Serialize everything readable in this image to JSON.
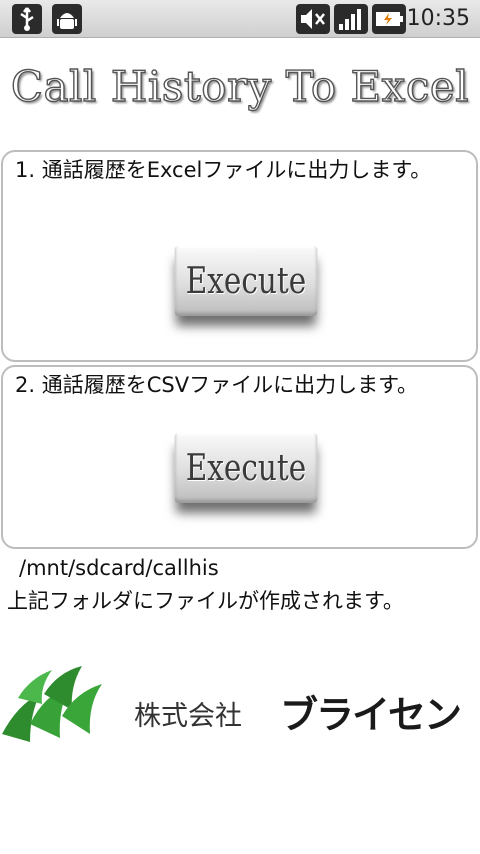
{
  "status_bar": {
    "time": "10:35",
    "icons": [
      "usb-icon",
      "android-debug-icon",
      "mute-icon",
      "signal-icon",
      "battery-charging-icon"
    ]
  },
  "app": {
    "title": "Call History To Excel"
  },
  "sections": [
    {
      "description": "1. 通話履歴をExcelファイルに出力します。",
      "button_label": "Execute"
    },
    {
      "description": "2. 通話履歴をCSVファイルに出力します。",
      "button_label": "Execute"
    }
  ],
  "output": {
    "path": "/mnt/sdcard/callhis",
    "note": "上記フォルダにファイルが作成されます。"
  },
  "company": {
    "prefix": "株式会社",
    "name": "ブライセン",
    "brand_color": "#2e8b2e"
  }
}
